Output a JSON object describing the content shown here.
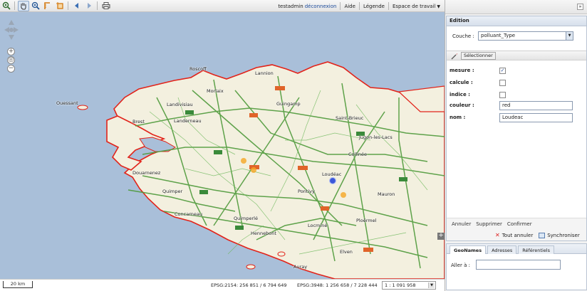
{
  "toolbar": {
    "tools": [
      "zoom-max-extent-icon",
      "pan-hand-icon",
      "zoom-in-icon",
      "measure-length-icon",
      "measure-area-icon",
      "previous-view-icon",
      "next-view-icon",
      "print-icon"
    ],
    "user": "testadmin",
    "logout": "déconnexion",
    "help": "Aide",
    "legend": "Légende",
    "workspace": "Espace de travail"
  },
  "map": {
    "places": [
      "Roscoff",
      "Ouessant",
      "Landivisiau",
      "Morlaix",
      "Lannion",
      "Brest",
      "Landerneau",
      "Guingamp",
      "Saint-Brieuc",
      "Jugon-les-Lacs",
      "Collinée",
      "Douarnenez",
      "Quimper",
      "Loudéac",
      "Pontivy",
      "Mauron",
      "Concarneau",
      "Quimperlé",
      "Ploërmel",
      "Hennebont",
      "Locminé",
      "Auray",
      "Elven"
    ],
    "colors": {
      "sea": "#a9bfd9",
      "land": "#f3f0df",
      "road": "#4e9a3a",
      "coast": "#e2231a"
    }
  },
  "status": {
    "scale_bar": "20 km",
    "coord_2154": "EPSG:2154: 256 851 / 6 794 649",
    "coord_3948": "EPSG:3948: 1 256 658 / 7 228 444",
    "scale": "1 : 1 091 958"
  },
  "edition": {
    "title": "Edition",
    "couche_label": "Couche :",
    "couche_value": "polluant_Type",
    "select_button": "Sélectionner",
    "fields": [
      {
        "label": "mesure :",
        "type": "checkbox",
        "checked": true
      },
      {
        "label": "calcule :",
        "type": "checkbox",
        "checked": false
      },
      {
        "label": "indice :",
        "type": "checkbox",
        "checked": false
      },
      {
        "label": "couleur :",
        "type": "text",
        "value": "red"
      },
      {
        "label": "nom :",
        "type": "text",
        "value": "Loudeac"
      }
    ],
    "annuler": "Annuler",
    "supprimer": "Supprimer",
    "confirmer": "Confirmer",
    "tout_annuler": "Tout annuler",
    "synchroniser": "Synchroniser"
  },
  "geo": {
    "tabs": [
      "GeoNames",
      "Adresses",
      "Référentiels"
    ],
    "goto_label": "Aller à :"
  }
}
